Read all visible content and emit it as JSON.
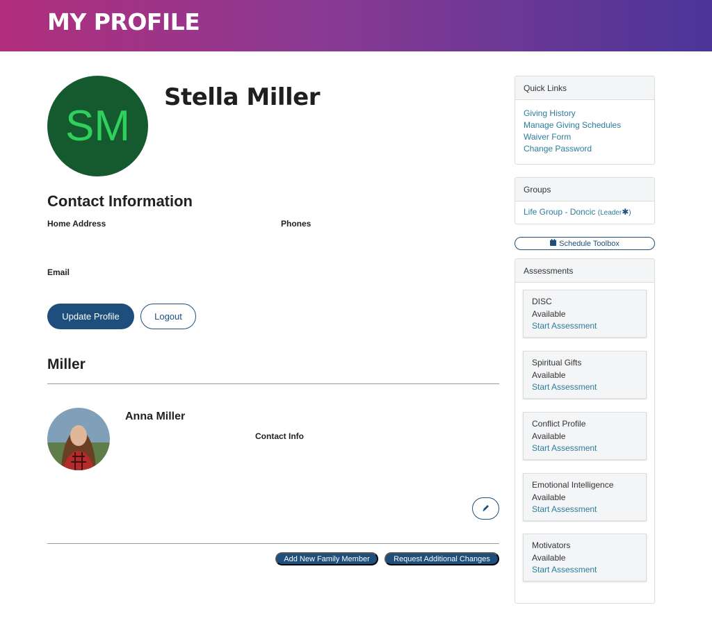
{
  "header": {
    "title": "MY PROFILE"
  },
  "profile": {
    "initials": "SM",
    "name": "Stella Miller"
  },
  "contact": {
    "title": "Contact Information",
    "home_address_label": "Home Address",
    "phones_label": "Phones",
    "email_label": "Email"
  },
  "actions": {
    "update_label": "Update Profile",
    "logout_label": "Logout"
  },
  "family": {
    "title": "Miller",
    "members": [
      {
        "name": "Anna Miller",
        "contact_label": "Contact Info"
      }
    ],
    "add_label": "Add New Family Member",
    "request_label": "Request Additional Changes"
  },
  "quick_links": {
    "title": "Quick Links",
    "items": [
      "Giving History",
      "Manage Giving Schedules",
      "Waiver Form",
      "Change Password"
    ]
  },
  "groups": {
    "title": "Groups",
    "items": [
      {
        "name": "Life Group - Doncic",
        "role": "(Leader",
        "marker": "✱",
        "close": ")"
      }
    ]
  },
  "schedule_toolbox": {
    "label": "Schedule Toolbox"
  },
  "assessments": {
    "title": "Assessments",
    "items": [
      {
        "name": "DISC",
        "status": "Available",
        "action": "Start Assessment"
      },
      {
        "name": "Spiritual Gifts",
        "status": "Available",
        "action": "Start Assessment"
      },
      {
        "name": "Conflict Profile",
        "status": "Available",
        "action": "Start Assessment"
      },
      {
        "name": "Emotional Intelligence",
        "status": "Available",
        "action": "Start Assessment"
      },
      {
        "name": "Motivators",
        "status": "Available",
        "action": "Start Assessment"
      }
    ]
  },
  "colors": {
    "banner_start": "#b12e7c",
    "banner_end": "#4b3598",
    "primary": "#1d4e7c",
    "link": "#2a7d9c",
    "avatar_bg": "#155a2e",
    "avatar_text": "#2fd15c"
  },
  "icons": {
    "calendar": "calendar-icon",
    "edit": "pencil-icon"
  }
}
